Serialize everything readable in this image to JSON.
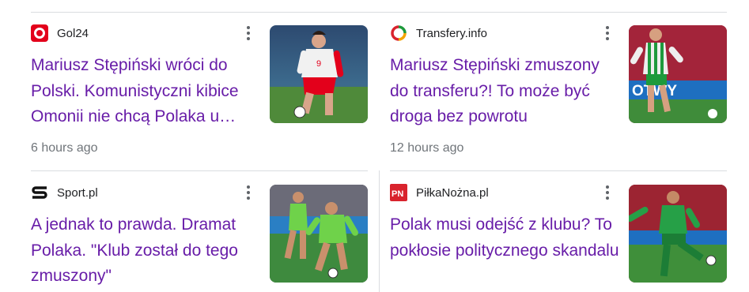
{
  "articles": [
    {
      "source": "Gol24",
      "source_icon": "gol24-logo-icon",
      "title": "Mariusz Stępiński wróci do Polski. Komunistyczni kibice Omonii nie chcą Polaka u…",
      "time": "6 hours ago",
      "thumbnail_alt": "player in white-red national kit with ball",
      "accent": "#e3001b"
    },
    {
      "source": "Transfery.info",
      "source_icon": "transfery-logo-icon",
      "title": "Mariusz Stępiński zmuszony do transferu?! To może być droga bez powrotu",
      "time": "12 hours ago",
      "thumbnail_alt": "player in green-white striped kit in stadium",
      "accent": "#1e9a3c"
    },
    {
      "source": "Sport.pl",
      "source_icon": "sport-pl-logo-icon",
      "title": "A jednak to prawda. Dramat Polaka. \"Klub został do tego zmuszony\"",
      "time": "",
      "thumbnail_alt": "players in green training kits",
      "accent": "#111111"
    },
    {
      "source": "PiłkaNożna.pl",
      "source_icon": "pilkanozna-logo-icon",
      "title": "Polak musi odejść z klubu? To pokłosie politycznego skandalu",
      "time": "",
      "thumbnail_alt": "player in green kit kicking ball",
      "accent": "#d9232d"
    }
  ],
  "colors": {
    "title": "#681da8",
    "time": "#70757a",
    "divider": "#dadce0"
  }
}
